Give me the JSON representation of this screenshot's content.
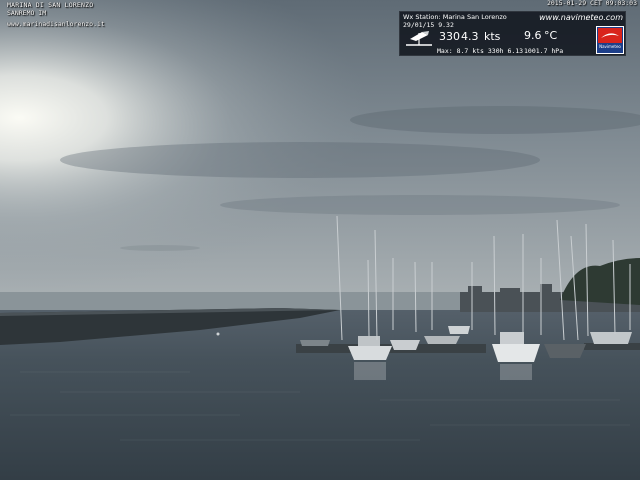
{
  "camera": {
    "title": "MARINA DI SAN LORENZO",
    "subtitle": "SANREMO IM",
    "url": "www.marinadisanlorenzo.it",
    "timestamp": "2015-01-29 CET 09:03:03"
  },
  "weather_panel": {
    "station": "Wx Station: Marina San Lorenzo",
    "site": "www.navimeteo.com",
    "date_time": "29/01/15  9.32",
    "wind_direction": "330",
    "wind_speed": "4.3",
    "wind_unit": "kts",
    "temperature": "9.6",
    "temperature_unit": "°C",
    "max_line": "Max:  8.7  kts 330h  6.13",
    "pressure": "1001.7 hPa",
    "logo_label": "Navimeteo",
    "icon": "wind-vane-icon"
  },
  "colors": {
    "sky_top": "#6d7a85",
    "sky_glow": "#f2f3ee",
    "sea": "#3e4a52",
    "panel_bg": "#0f141c",
    "logo_red": "#d9241c",
    "logo_blue": "#1d3f8a"
  }
}
